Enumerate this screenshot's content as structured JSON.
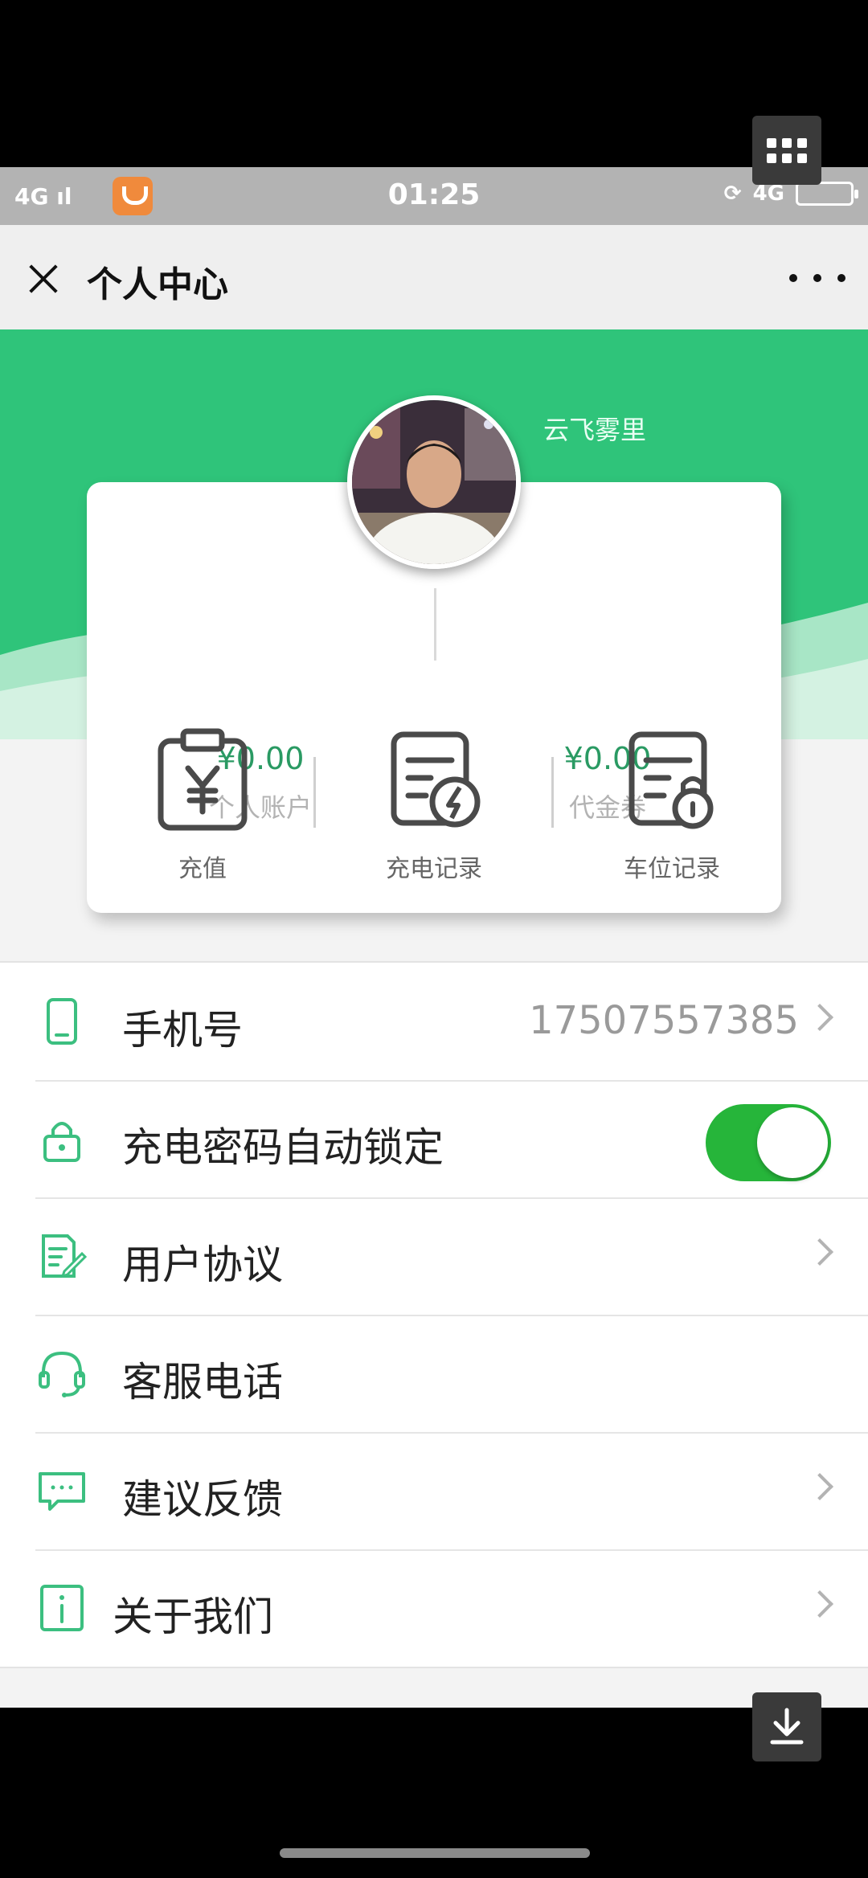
{
  "status_bar": {
    "network": "4G",
    "time": "01:25",
    "right_network": "4G"
  },
  "header": {
    "title": "个人中心"
  },
  "profile": {
    "username": "云飞雾里"
  },
  "balances": [
    {
      "value": "¥0.00",
      "label": "个人账户"
    },
    {
      "value": "¥0.00",
      "label": "代金券"
    }
  ],
  "actions": [
    {
      "label": "充值",
      "icon": "recharge-yuan-icon"
    },
    {
      "label": "充电记录",
      "icon": "charging-record-icon"
    },
    {
      "label": "车位记录",
      "icon": "parking-record-lock-icon"
    }
  ],
  "menu": [
    {
      "label": "手机号",
      "value": "17507557385",
      "icon": "phone-icon",
      "chevron": true
    },
    {
      "label": "充电密码自动锁定",
      "icon": "lock-icon",
      "toggle": true,
      "toggle_on": true
    },
    {
      "label": "用户协议",
      "icon": "agreement-document-icon",
      "chevron": true
    },
    {
      "label": "客服电话",
      "icon": "headset-icon",
      "chevron": false
    },
    {
      "label": "建议反馈",
      "icon": "chat-bubble-icon",
      "chevron": true
    },
    {
      "label": "关于我们",
      "icon": "info-icon",
      "chevron": true
    }
  ],
  "colors": {
    "accent_green": "#2fc47a",
    "toggle_green": "#26b53a",
    "money_green": "#2a9a63"
  }
}
